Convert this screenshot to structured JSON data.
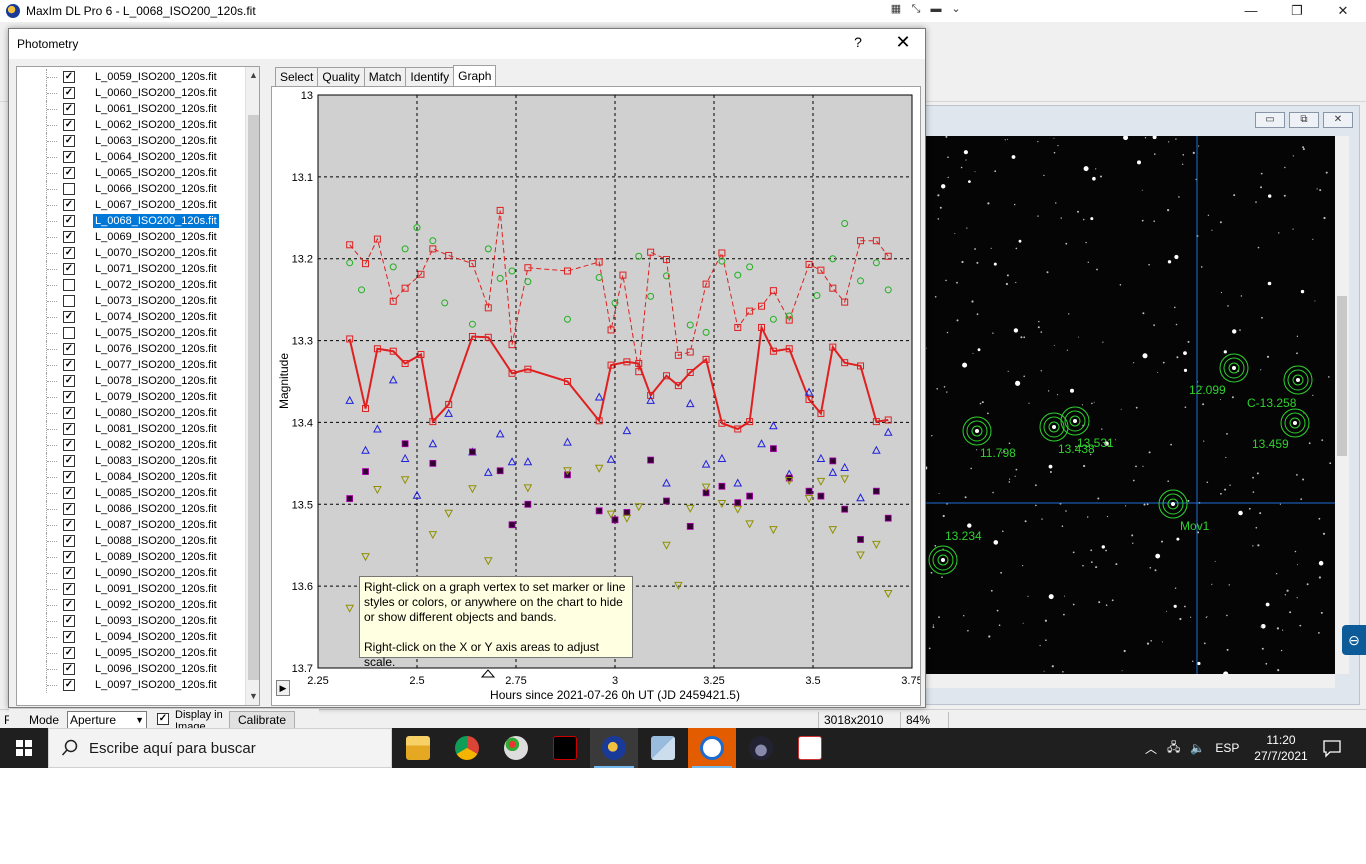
{
  "app": {
    "title": "MaxIm DL Pro 6 - L_0068_ISO200_120s.fit",
    "status_left": "For",
    "status_dims": "3018x2010",
    "status_zoom": "84%"
  },
  "dialog": {
    "title": "Photometry",
    "help": "?",
    "close": "✕",
    "tabs": [
      "Select",
      "Quality",
      "Match",
      "Identify",
      "Graph"
    ],
    "active_tab": "Graph",
    "files": [
      {
        "name": "L_0059_ISO200_120s.fit",
        "checked": true
      },
      {
        "name": "L_0060_ISO200_120s.fit",
        "checked": true
      },
      {
        "name": "L_0061_ISO200_120s.fit",
        "checked": true
      },
      {
        "name": "L_0062_ISO200_120s.fit",
        "checked": true
      },
      {
        "name": "L_0063_ISO200_120s.fit",
        "checked": true
      },
      {
        "name": "L_0064_ISO200_120s.fit",
        "checked": true
      },
      {
        "name": "L_0065_ISO200_120s.fit",
        "checked": true
      },
      {
        "name": "L_0066_ISO200_120s.fit",
        "checked": false
      },
      {
        "name": "L_0067_ISO200_120s.fit",
        "checked": true
      },
      {
        "name": "L_0068_ISO200_120s.fit",
        "checked": true,
        "selected": true
      },
      {
        "name": "L_0069_ISO200_120s.fit",
        "checked": true
      },
      {
        "name": "L_0070_ISO200_120s.fit",
        "checked": true
      },
      {
        "name": "L_0071_ISO200_120s.fit",
        "checked": true
      },
      {
        "name": "L_0072_ISO200_120s.fit",
        "checked": false
      },
      {
        "name": "L_0073_ISO200_120s.fit",
        "checked": false
      },
      {
        "name": "L_0074_ISO200_120s.fit",
        "checked": true
      },
      {
        "name": "L_0075_ISO200_120s.fit",
        "checked": false
      },
      {
        "name": "L_0076_ISO200_120s.fit",
        "checked": true
      },
      {
        "name": "L_0077_ISO200_120s.fit",
        "checked": true
      },
      {
        "name": "L_0078_ISO200_120s.fit",
        "checked": true
      },
      {
        "name": "L_0079_ISO200_120s.fit",
        "checked": true
      },
      {
        "name": "L_0080_ISO200_120s.fit",
        "checked": true
      },
      {
        "name": "L_0081_ISO200_120s.fit",
        "checked": true
      },
      {
        "name": "L_0082_ISO200_120s.fit",
        "checked": true
      },
      {
        "name": "L_0083_ISO200_120s.fit",
        "checked": true
      },
      {
        "name": "L_0084_ISO200_120s.fit",
        "checked": true
      },
      {
        "name": "L_0085_ISO200_120s.fit",
        "checked": true
      },
      {
        "name": "L_0086_ISO200_120s.fit",
        "checked": true
      },
      {
        "name": "L_0087_ISO200_120s.fit",
        "checked": true
      },
      {
        "name": "L_0088_ISO200_120s.fit",
        "checked": true
      },
      {
        "name": "L_0089_ISO200_120s.fit",
        "checked": true
      },
      {
        "name": "L_0090_ISO200_120s.fit",
        "checked": true
      },
      {
        "name": "L_0091_ISO200_120s.fit",
        "checked": true
      },
      {
        "name": "L_0092_ISO200_120s.fit",
        "checked": true
      },
      {
        "name": "L_0093_ISO200_120s.fit",
        "checked": true
      },
      {
        "name": "L_0094_ISO200_120s.fit",
        "checked": true
      },
      {
        "name": "L_0095_ISO200_120s.fit",
        "checked": true
      },
      {
        "name": "L_0096_ISO200_120s.fit",
        "checked": true
      },
      {
        "name": "L_0097_ISO200_120s.fit",
        "checked": true
      }
    ],
    "bottom": {
      "mode_label": "Mode",
      "mode_value": "Aperture",
      "display_label": "Display in Image",
      "calibrate_label": "Calibrate <<"
    }
  },
  "tooltip": {
    "line1": "Right-click on a graph vertex to set marker or line styles or colors, or anywhere on the chart to hide or show different objects and bands.",
    "line2": "Right-click on the X or Y axis areas to adjust scale."
  },
  "chart_data": {
    "type": "scatter",
    "xlabel": "Hours since 2021-07-26 0h UT (JD 2459421.5)",
    "ylabel": "Magnitude",
    "xlim": [
      2.25,
      3.75
    ],
    "ylim": [
      13.0,
      13.7
    ],
    "y_inverted": true,
    "x_ticks": [
      "2.25",
      "2.5",
      "2.75",
      "3",
      "3.25",
      "3.5",
      "3.75"
    ],
    "y_ticks": [
      "13",
      "13.1",
      "13.2",
      "13.3",
      "13.4",
      "13.5",
      "13.6",
      "13.7"
    ],
    "grid": true,
    "series": [
      {
        "marker": "square",
        "color": "#e02020",
        "line": "solid",
        "x": [
          2.33,
          2.37,
          2.4,
          2.44,
          2.47,
          2.51,
          2.54,
          2.58,
          2.64,
          2.68,
          2.74,
          2.78,
          2.88,
          2.96,
          2.99,
          3.03,
          3.06,
          3.09,
          3.13,
          3.16,
          3.19,
          3.23,
          3.27,
          3.31,
          3.34,
          3.37,
          3.4,
          3.44,
          3.49,
          3.52,
          3.55,
          3.58,
          3.62,
          3.66,
          3.69
        ],
        "y": [
          13.298,
          13.383,
          13.31,
          13.313,
          13.328,
          13.317,
          13.399,
          13.378,
          13.295,
          13.296,
          13.34,
          13.335,
          13.35,
          13.398,
          13.33,
          13.326,
          13.328,
          13.367,
          13.343,
          13.355,
          13.339,
          13.323,
          13.401,
          13.408,
          13.399,
          13.284,
          13.313,
          13.31,
          13.372,
          13.389,
          13.308,
          13.327,
          13.331,
          13.399,
          13.397
        ]
      },
      {
        "marker": "square",
        "color": "#e02020",
        "line": "dashed",
        "x": [
          2.33,
          2.37,
          2.4,
          2.44,
          2.47,
          2.51,
          2.54,
          2.58,
          2.64,
          2.68,
          2.71,
          2.74,
          2.78,
          2.88,
          2.96,
          2.99,
          3.02,
          3.06,
          3.09,
          3.13,
          3.16,
          3.19,
          3.23,
          3.27,
          3.31,
          3.34,
          3.37,
          3.4,
          3.44,
          3.49,
          3.52,
          3.55,
          3.58,
          3.62,
          3.66,
          3.69
        ],
        "y": [
          13.183,
          13.206,
          13.176,
          13.252,
          13.236,
          13.219,
          13.188,
          13.196,
          13.206,
          13.26,
          13.141,
          13.305,
          13.211,
          13.215,
          13.204,
          13.287,
          13.22,
          13.338,
          13.192,
          13.201,
          13.318,
          13.314,
          13.231,
          13.193,
          13.284,
          13.264,
          13.258,
          13.239,
          13.275,
          13.207,
          13.214,
          13.236,
          13.253,
          13.178,
          13.178,
          13.197
        ]
      },
      {
        "marker": "circle",
        "color": "#20b020",
        "x": [
          2.33,
          2.36,
          2.44,
          2.47,
          2.5,
          2.54,
          2.57,
          2.64,
          2.68,
          2.71,
          2.74,
          2.78,
          2.88,
          2.96,
          3.0,
          3.06,
          3.09,
          3.13,
          3.19,
          3.23,
          3.27,
          3.31,
          3.34,
          3.4,
          3.44,
          3.51,
          3.55,
          3.58,
          3.62,
          3.66,
          3.69
        ],
        "y": [
          13.205,
          13.238,
          13.21,
          13.188,
          13.162,
          13.178,
          13.254,
          13.28,
          13.188,
          13.224,
          13.215,
          13.228,
          13.274,
          13.223,
          13.254,
          13.197,
          13.246,
          13.221,
          13.281,
          13.29,
          13.203,
          13.22,
          13.21,
          13.274,
          13.27,
          13.245,
          13.2,
          13.157,
          13.227,
          13.205,
          13.238
        ]
      },
      {
        "marker": "triangle",
        "color": "#2020e0",
        "x": [
          2.33,
          2.37,
          2.4,
          2.44,
          2.47,
          2.5,
          2.54,
          2.58,
          2.64,
          2.68,
          2.71,
          2.74,
          2.78,
          2.88,
          2.96,
          2.99,
          3.03,
          3.09,
          3.13,
          3.19,
          3.23,
          3.27,
          3.31,
          3.37,
          3.4,
          3.44,
          3.49,
          3.52,
          3.55,
          3.58,
          3.62,
          3.66,
          3.69
        ],
        "y": [
          13.373,
          13.434,
          13.408,
          13.348,
          13.444,
          13.489,
          13.426,
          13.389,
          13.436,
          13.461,
          13.414,
          13.448,
          13.448,
          13.424,
          13.369,
          13.445,
          13.41,
          13.373,
          13.474,
          13.377,
          13.451,
          13.444,
          13.474,
          13.426,
          13.404,
          13.463,
          13.363,
          13.444,
          13.461,
          13.455,
          13.492,
          13.434,
          13.412
        ]
      },
      {
        "marker": "filled-square",
        "color": "#300030",
        "x": [
          2.33,
          2.37,
          2.47,
          2.54,
          2.64,
          2.71,
          2.74,
          2.78,
          2.88,
          2.96,
          3.0,
          3.03,
          3.09,
          3.13,
          3.19,
          3.23,
          3.27,
          3.31,
          3.34,
          3.4,
          3.44,
          3.49,
          3.52,
          3.55,
          3.58,
          3.62,
          3.66,
          3.69
        ],
        "y": [
          13.493,
          13.46,
          13.426,
          13.45,
          13.436,
          13.459,
          13.525,
          13.5,
          13.464,
          13.508,
          13.519,
          13.51,
          13.446,
          13.496,
          13.527,
          13.486,
          13.478,
          13.498,
          13.49,
          13.432,
          13.468,
          13.484,
          13.49,
          13.447,
          13.506,
          13.543,
          13.484,
          13.517
        ]
      },
      {
        "marker": "triangle-down",
        "color": "#909000",
        "x": [
          2.33,
          2.37,
          2.4,
          2.47,
          2.54,
          2.58,
          2.64,
          2.68,
          2.78,
          2.88,
          2.96,
          2.99,
          3.03,
          3.06,
          3.13,
          3.16,
          3.19,
          3.23,
          3.27,
          3.31,
          3.34,
          3.4,
          3.44,
          3.49,
          3.52,
          3.55,
          3.58,
          3.62,
          3.66,
          3.69
        ],
        "y": [
          13.627,
          13.564,
          13.482,
          13.47,
          13.537,
          13.511,
          13.481,
          13.569,
          13.48,
          13.459,
          13.456,
          13.512,
          13.517,
          13.503,
          13.55,
          13.599,
          13.505,
          13.479,
          13.499,
          13.506,
          13.524,
          13.531,
          13.471,
          13.493,
          13.472,
          13.531,
          13.469,
          13.562,
          13.549,
          13.609
        ]
      }
    ]
  },
  "image_labels": [
    {
      "text": "12.099"
    },
    {
      "text": "C-13.258"
    },
    {
      "text": "11.798"
    },
    {
      "text": "13.438"
    },
    {
      "text": "13.531"
    },
    {
      "text": "13.459"
    },
    {
      "text": "Mov1"
    },
    {
      "text": "13.234"
    }
  ],
  "taskbar": {
    "search_placeholder": "Escribe aquí para buscar",
    "language": "ESP",
    "time": "11:20",
    "date": "27/7/2021"
  }
}
